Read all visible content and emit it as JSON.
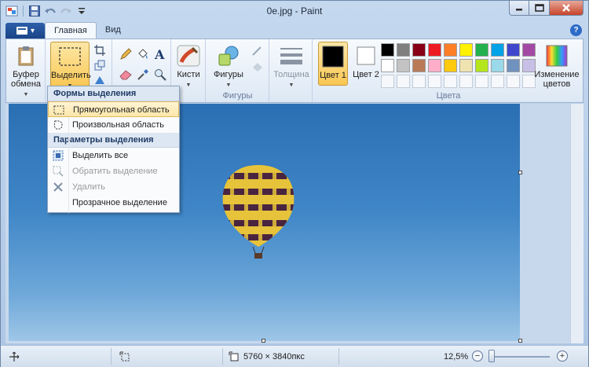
{
  "window": {
    "title": "0e.jpg - Paint"
  },
  "tabs": [
    {
      "label": "Главная",
      "active": true
    },
    {
      "label": "Вид",
      "active": false
    }
  ],
  "ribbon": {
    "clipboard": {
      "label": "Буфер обмена"
    },
    "image": {
      "select_label": "Выделить"
    },
    "brushes": {
      "label": "Кисти"
    },
    "shapes": {
      "button_label": "Фигуры",
      "group_label": "Фигуры"
    },
    "size": {
      "label": "Толщина"
    },
    "color1": {
      "label": "Цвет 1",
      "value": "#000000"
    },
    "color2": {
      "label": "Цвет 2",
      "value": "#ffffff"
    },
    "colors_group_label": "Цвета",
    "edit_colors": {
      "label": "Изменение цветов"
    },
    "palette": [
      "#000000",
      "#7f7f7f",
      "#880015",
      "#ed1c24",
      "#ff7f27",
      "#fff200",
      "#22b14c",
      "#00a2e8",
      "#3f48cc",
      "#a349a4",
      "#ffffff",
      "#c3c3c3",
      "#b97a57",
      "#ffaec9",
      "#ffc90e",
      "#efe4b0",
      "#b5e61d",
      "#99d9ea",
      "#7092be",
      "#c8bfe7"
    ]
  },
  "select_menu": {
    "shapes_header": "Формы выделения",
    "rect": "Прямоугольная область",
    "freeform": "Произвольная область",
    "options_header": "Параметры выделения",
    "select_all": "Выделить все",
    "invert": "Обратить выделение",
    "delete": "Удалить",
    "transparent": "Прозрачное выделение"
  },
  "status": {
    "image_size": "5760 × 3840пкс",
    "zoom": "12,5%",
    "zoom_fraction": 0.06
  },
  "colors": {
    "sky_top": "#2b6fb3",
    "sky_bottom": "#9ec6e7",
    "balloon_yellow": "#e6c33a",
    "balloon_dark": "#4a2540",
    "accent": "#2c5fa9"
  }
}
